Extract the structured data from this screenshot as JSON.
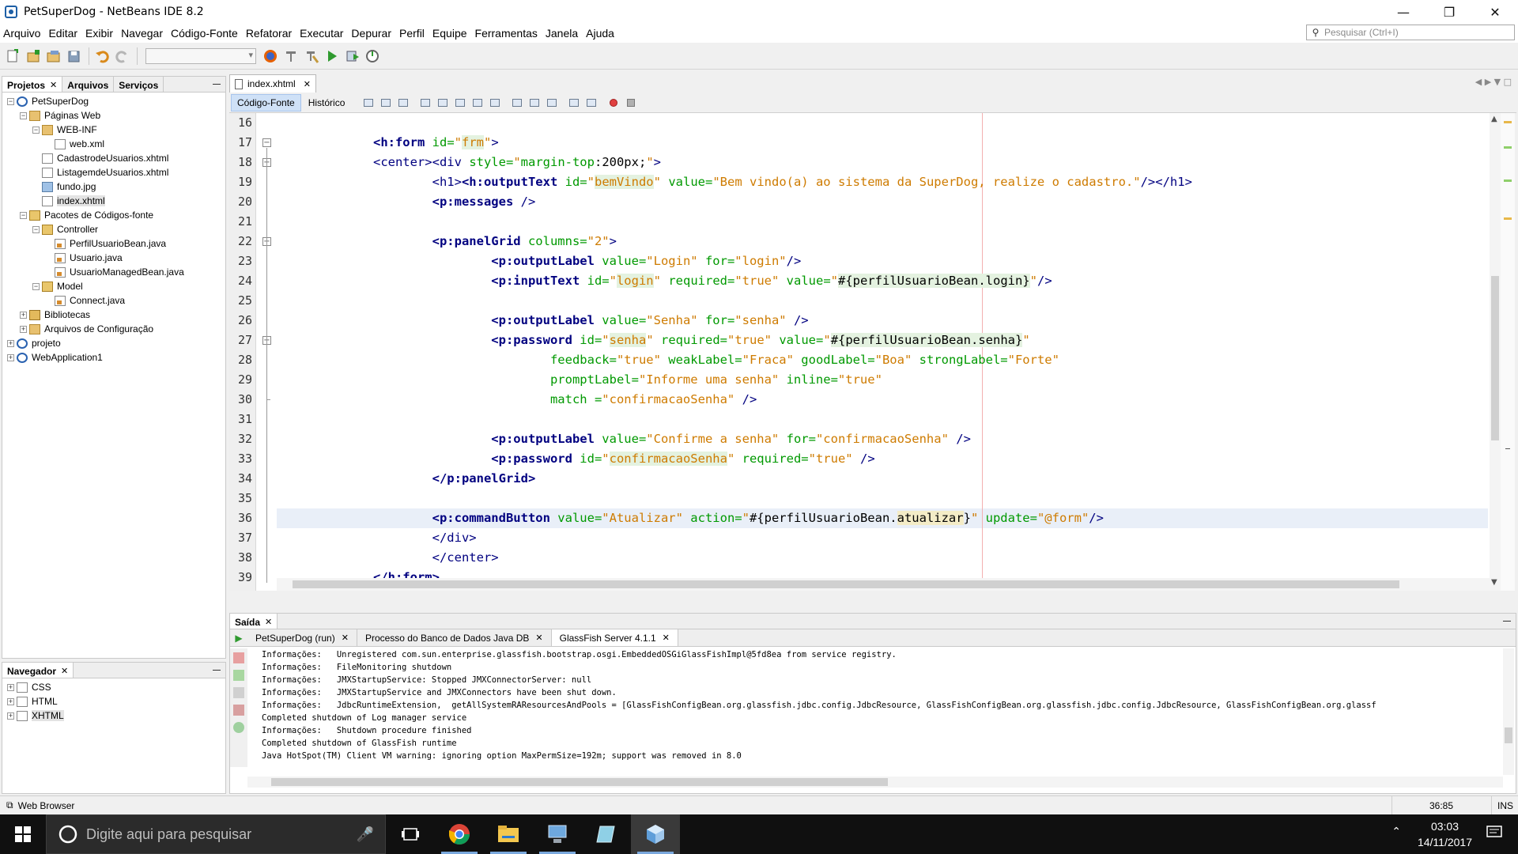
{
  "window": {
    "title": "PetSuperDog - NetBeans IDE 8.2"
  },
  "menu": [
    "Arquivo",
    "Editar",
    "Exibir",
    "Navegar",
    "Código-Fonte",
    "Refatorar",
    "Executar",
    "Depurar",
    "Perfil",
    "Equipe",
    "Ferramentas",
    "Janela",
    "Ajuda"
  ],
  "search": {
    "placeholder": "Pesquisar (Ctrl+I)"
  },
  "projects_panel": {
    "tabs": [
      "Projetos",
      "Arquivos",
      "Serviços"
    ],
    "tree": [
      {
        "label": "PetSuperDog",
        "level": 0,
        "icon": "project-icon",
        "exp": "−"
      },
      {
        "label": "Páginas Web",
        "level": 1,
        "icon": "folder-icon",
        "exp": "−"
      },
      {
        "label": "WEB-INF",
        "level": 2,
        "icon": "folder-icon",
        "exp": "−"
      },
      {
        "label": "web.xml",
        "level": 3,
        "icon": "xml-file-icon",
        "exp": ""
      },
      {
        "label": "CadastrodeUsuarios.xhtml",
        "level": 2,
        "icon": "xhtml-file-icon",
        "exp": ""
      },
      {
        "label": "ListagemdeUsuarios.xhtml",
        "level": 2,
        "icon": "xhtml-file-icon",
        "exp": ""
      },
      {
        "label": "fundo.jpg",
        "level": 2,
        "icon": "image-file-icon",
        "exp": ""
      },
      {
        "label": "index.xhtml",
        "level": 2,
        "icon": "xhtml-file-icon",
        "exp": "",
        "selected": true
      },
      {
        "label": "Pacotes de Códigos-fonte",
        "level": 1,
        "icon": "source-package-icon",
        "exp": "−"
      },
      {
        "label": "Controller",
        "level": 2,
        "icon": "package-icon",
        "exp": "−"
      },
      {
        "label": "PerfilUsuarioBean.java",
        "level": 3,
        "icon": "java-file-icon",
        "exp": ""
      },
      {
        "label": "Usuario.java",
        "level": 3,
        "icon": "java-file-icon",
        "exp": ""
      },
      {
        "label": "UsuarioManagedBean.java",
        "level": 3,
        "icon": "java-file-icon",
        "exp": ""
      },
      {
        "label": "Model",
        "level": 2,
        "icon": "package-icon",
        "exp": "−"
      },
      {
        "label": "Connect.java",
        "level": 3,
        "icon": "java-file-icon",
        "exp": ""
      },
      {
        "label": "Bibliotecas",
        "level": 1,
        "icon": "library-icon",
        "exp": "+"
      },
      {
        "label": "Arquivos de Configuração",
        "level": 1,
        "icon": "config-folder-icon",
        "exp": "+"
      },
      {
        "label": "projeto",
        "level": 0,
        "icon": "project-icon",
        "exp": "+"
      },
      {
        "label": "WebApplication1",
        "level": 0,
        "icon": "project-icon",
        "exp": "+"
      }
    ]
  },
  "navigator": {
    "title": "Navegador",
    "items": [
      {
        "label": "CSS"
      },
      {
        "label": "HTML"
      },
      {
        "label": "XHTML",
        "selected": true
      }
    ]
  },
  "editor": {
    "tab": "index.xhtml",
    "source_button": "Código-Fonte",
    "history_button": "Histórico",
    "lines": [
      "16",
      "17",
      "18",
      "19",
      "20",
      "21",
      "22",
      "23",
      "24",
      "25",
      "26",
      "27",
      "28",
      "29",
      "30",
      "31",
      "32",
      "33",
      "34",
      "35",
      "36",
      "37",
      "38",
      "39"
    ]
  },
  "output": {
    "title": "Saída",
    "tabs": [
      "PetSuperDog (run)",
      "Processo do Banco de Dados Java DB",
      "GlassFish Server 4.1.1"
    ],
    "log": "Informações:   Unregistered com.sun.enterprise.glassfish.bootstrap.osgi.EmbeddedOSGiGlassFishImpl@5fd8ea from service registry.\nInformações:   FileMonitoring shutdown\nInformações:   JMXStartupService: Stopped JMXConnectorServer: null\nInformações:   JMXStartupService and JMXConnectors have been shut down.\nInformações:   JdbcRuntimeExtension,  getAllSystemRAResourcesAndPools = [GlassFishConfigBean.org.glassfish.jdbc.config.JdbcResource, GlassFishConfigBean.org.glassfish.jdbc.config.JdbcResource, GlassFishConfigBean.org.glassf\nCompleted shutdown of Log manager service\nInformações:   Shutdown procedure finished\nCompleted shutdown of GlassFish runtime\nJava HotSpot(TM) Client VM warning: ignoring option MaxPermSize=192m; support was removed in 8.0"
  },
  "status": {
    "left": "Web Browser",
    "position": "36:85",
    "mode": "INS"
  },
  "taskbar": {
    "search_placeholder": "Digite aqui para pesquisar",
    "time": "03:03",
    "date": "14/11/2017"
  }
}
